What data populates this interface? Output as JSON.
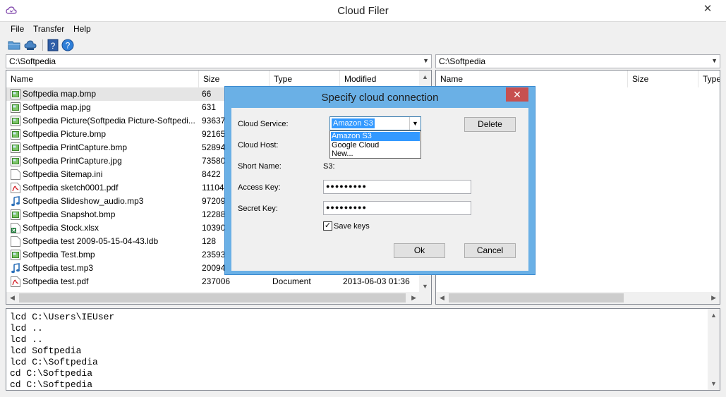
{
  "window": {
    "title": "Cloud Filer",
    "close_glyph": "✕"
  },
  "menu": [
    "File",
    "Transfer",
    "Help"
  ],
  "toolbar": {
    "icons": [
      "open-folder-icon",
      "cloud-connect-icon",
      "help-topics-icon",
      "about-icon"
    ]
  },
  "left_pane": {
    "path": "C:\\Softpedia",
    "columns": [
      "Name",
      "Size",
      "Type",
      "Modified"
    ],
    "rows": [
      {
        "name": "Softpedia map.bmp",
        "size": "66",
        "type": "",
        "modified": "",
        "icon": "image"
      },
      {
        "name": "Softpedia map.jpg",
        "size": "631",
        "type": "",
        "modified": "",
        "icon": "image"
      },
      {
        "name": "Softpedia Picture(Softpedia Picture-Softpedi...",
        "size": "936374",
        "type": "",
        "modified": "",
        "icon": "image"
      },
      {
        "name": "Softpedia Picture.bmp",
        "size": "921654",
        "type": "",
        "modified": "",
        "icon": "image"
      },
      {
        "name": "Softpedia PrintCapture.bmp",
        "size": "528948",
        "type": "",
        "modified": "",
        "icon": "image"
      },
      {
        "name": "Softpedia PrintCapture.jpg",
        "size": "73580",
        "type": "",
        "modified": "",
        "icon": "image"
      },
      {
        "name": "Softpedia Sitemap.ini",
        "size": "8422",
        "type": "",
        "modified": "",
        "icon": "text"
      },
      {
        "name": "Softpedia sketch0001.pdf",
        "size": "111043",
        "type": "",
        "modified": "",
        "icon": "pdf"
      },
      {
        "name": "Softpedia Slideshow_audio.mp3",
        "size": "972099",
        "type": "",
        "modified": "",
        "icon": "audio"
      },
      {
        "name": "Softpedia Snapshot.bmp",
        "size": "122885",
        "type": "",
        "modified": "",
        "icon": "image"
      },
      {
        "name": "Softpedia Stock.xlsx",
        "size": "10390",
        "type": "",
        "modified": "",
        "icon": "excel"
      },
      {
        "name": "Softpedia test 2009-05-15-04-43.ldb",
        "size": "128",
        "type": "",
        "modified": "",
        "icon": "text"
      },
      {
        "name": "Softpedia Test.bmp",
        "size": "235935",
        "type": "",
        "modified": "",
        "icon": "image"
      },
      {
        "name": "Softpedia test.mp3",
        "size": "200942",
        "type": "",
        "modified": "",
        "icon": "audio"
      },
      {
        "name": "Softpedia test.pdf",
        "size": "237006",
        "type": "Document",
        "modified": "2013-06-03 01:36",
        "icon": "pdf"
      }
    ]
  },
  "right_pane": {
    "path": "C:\\Softpedia",
    "columns": [
      "Name",
      "Size",
      "Type"
    ]
  },
  "log": [
    "lcd C:\\Users\\IEUser",
    "lcd ..",
    "lcd ..",
    "lcd Softpedia",
    "lcd C:\\Softpedia",
    "cd C:\\Softpedia",
    "cd C:\\Softpedia"
  ],
  "dialog": {
    "title": "Specify cloud connection",
    "close_glyph": "✕",
    "service_label": "Cloud Service:",
    "service_value": "Amazon S3",
    "service_options": [
      "Amazon S3",
      "Google Cloud",
      "New..."
    ],
    "host_label": "Cloud Host:",
    "short_name_label": "Short Name:",
    "short_name_value": "S3:",
    "access_key_label": "Access Key:",
    "access_key_value": "●●●●●●●●●",
    "secret_key_label": "Secret Key:",
    "secret_key_value": "●●●●●●●●●",
    "save_keys_label": "Save keys",
    "save_keys_checked": true,
    "check_glyph": "✓",
    "delete_label": "Delete",
    "ok_label": "Ok",
    "cancel_label": "Cancel"
  }
}
